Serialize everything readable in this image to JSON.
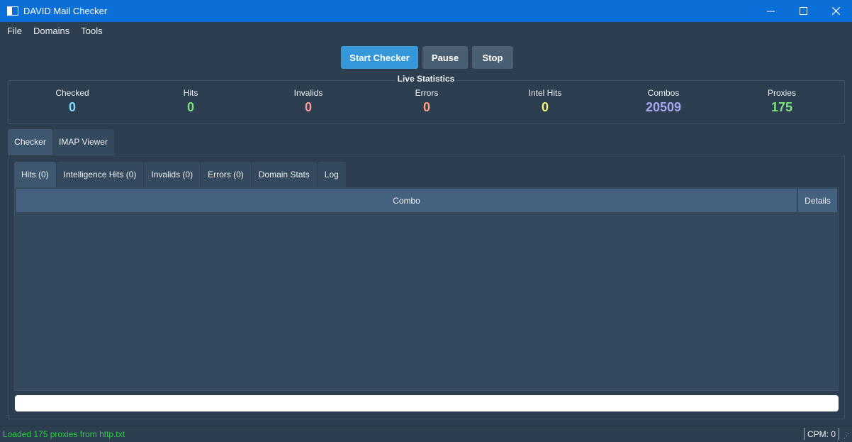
{
  "window": {
    "title": "DAVID Mail Checker",
    "minimize_icon": "minimize-icon",
    "maximize_icon": "maximize-icon",
    "close_icon": "close-icon"
  },
  "menu": [
    "File",
    "Domains",
    "Tools"
  ],
  "toolbar": {
    "start": "Start Checker",
    "pause": "Pause",
    "stop": "Stop"
  },
  "stats": {
    "title": "Live Statistics",
    "items": [
      {
        "label": "Checked",
        "value": "0",
        "color": "#7fdbff"
      },
      {
        "label": "Hits",
        "value": "0",
        "color": "#7ee07e"
      },
      {
        "label": "Invalids",
        "value": "0",
        "color": "#ff9a9a"
      },
      {
        "label": "Errors",
        "value": "0",
        "color": "#ffa07a"
      },
      {
        "label": "Intel Hits",
        "value": "0",
        "color": "#f4f17a"
      },
      {
        "label": "Combos",
        "value": "20509",
        "color": "#a3a8f0"
      },
      {
        "label": "Proxies",
        "value": "175",
        "color": "#7ee07e"
      }
    ]
  },
  "outer_tabs": [
    "Checker",
    "IMAP Viewer"
  ],
  "inner_tabs": [
    "Hits (0)",
    "Intelligence Hits (0)",
    "Invalids (0)",
    "Errors (0)",
    "Domain Stats",
    "Log"
  ],
  "table": {
    "columns": [
      "Combo",
      "Details"
    ]
  },
  "progress": {
    "value": 0
  },
  "status": {
    "message": "Loaded 175 proxies from http.txt",
    "cpm": "CPM: 0"
  },
  "colors": {
    "accent": "#3498db",
    "background": "#2c3e50",
    "titlebar": "#0a6fd6",
    "status_text": "#2ecc40"
  }
}
